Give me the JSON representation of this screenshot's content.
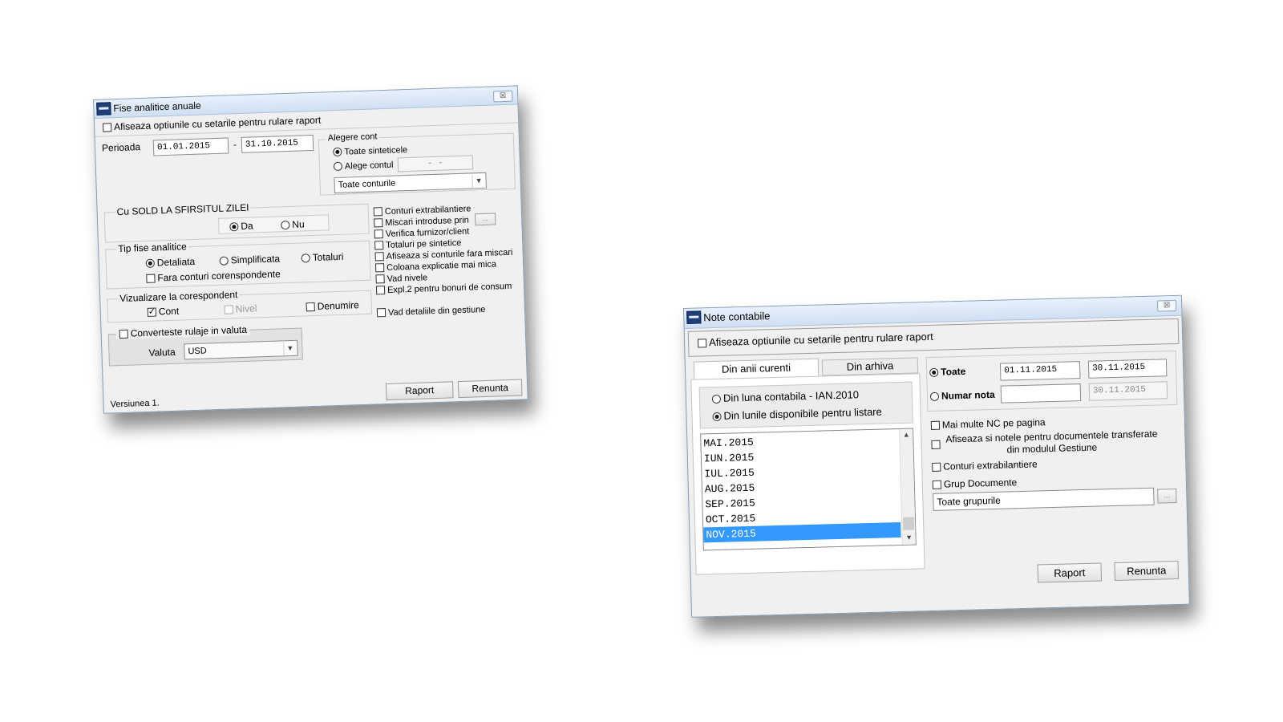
{
  "win1": {
    "title": "Fise analitice anuale",
    "close_label": "☒",
    "show_options_label": "Afiseaza optiunile cu setarile pentru rulare raport",
    "period_label": "Perioada",
    "date_from": "01.01.2015",
    "date_sep": "-",
    "date_to": "31.10.2015",
    "account_group": {
      "label": "Alegere cont",
      "all_synthetic": "Toate sinteticele",
      "choose_account": "Alege contul",
      "account_value": "- -",
      "accounts_select": "Toate conturile"
    },
    "sold_group": {
      "label": "Cu SOLD LA SFIRSITUL ZILEI",
      "yes": "Da",
      "no": "Nu"
    },
    "type_group": {
      "label": "Tip fise analitice",
      "detailed": "Detaliata",
      "simplified": "Simplificata",
      "totals": "Totaluri",
      "no_correspondents": "Fara conturi corenspondente"
    },
    "view_group": {
      "label": "Vizualizare la corespondent",
      "account": "Cont",
      "level": "Nivel",
      "name": "Denumire"
    },
    "options": [
      "Conturi extrabilantiere",
      "Miscari introduse prin",
      "Verifica furnizor/client",
      "Totaluri pe sintetice",
      "Afiseaza si conturile fara miscari",
      "Coloana explicatie mai mica",
      "Vad nivele",
      "Expl.2 pentru bonuri de consum"
    ],
    "ellipsis": "...",
    "gestiune_details": "Vad detaliile din gestiune",
    "currency_group": {
      "label": "Converteste rulaje in valuta",
      "currency_label": "Valuta",
      "currency_value": "USD"
    },
    "version": "Versiunea 1.",
    "report_button": "Raport",
    "cancel_button": "Renunta"
  },
  "win2": {
    "title": "Note contabile",
    "close_label": "☒",
    "show_options_label": "Afiseaza optiunile cu setarile pentru rulare raport",
    "tabs": [
      "Din anii curenti",
      "Din arhiva"
    ],
    "from_month": "Din luna contabila - IAN.2010",
    "from_available": "Din lunile disponibile pentru listare",
    "months": [
      "MAI.2015",
      "IUN.2015",
      "IUL.2015",
      "AUG.2015",
      "SEP.2015",
      "OCT.2015",
      "NOV.2015"
    ],
    "all_label": "Toate",
    "all_from": "01.11.2015",
    "all_to": "30.11.2015",
    "note_number_label": "Numar nota",
    "note_number_from": "",
    "note_number_to": "30.11.2015",
    "multiple_nc": "Mai multe NC pe pagina",
    "show_notes_line1": "Afiseaza si notele pentru documentele transferate",
    "show_notes_line2": "din modulul Gestiune",
    "off_balance": "Conturi extrabilantiere",
    "doc_group": "Grup Documente",
    "all_groups": "Toate grupurile",
    "ellipsis": "...",
    "report_button": "Raport",
    "cancel_button": "Renunta"
  }
}
